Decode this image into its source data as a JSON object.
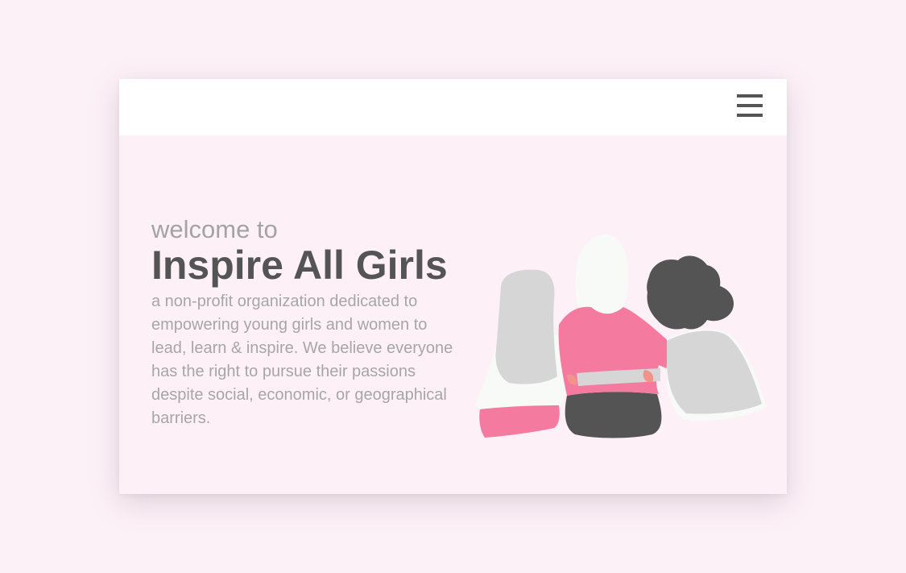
{
  "header": {
    "menu_icon": "hamburger-menu-icon"
  },
  "hero": {
    "welcome": "welcome to",
    "title": "Inspire All Girls",
    "description": "a non-profit organization dedicated to empowering young girls and women to lead, learn & inspire. We believe everyone has the right to pursue their passions despite social, economic, or geographical barriers."
  },
  "illustration": {
    "subject": "three-girls-hugging-from-behind",
    "colors": {
      "pink": "#f47aa0",
      "light_gray": "#d6d6d6",
      "dark_gray": "#545454",
      "off_white": "#f7faf6",
      "skin": "#f2928a"
    }
  },
  "colors": {
    "page_background": "#fdf1f8",
    "card_background": "#fdf0f7",
    "title": "#545454",
    "muted_text": "#a6a6a6"
  }
}
